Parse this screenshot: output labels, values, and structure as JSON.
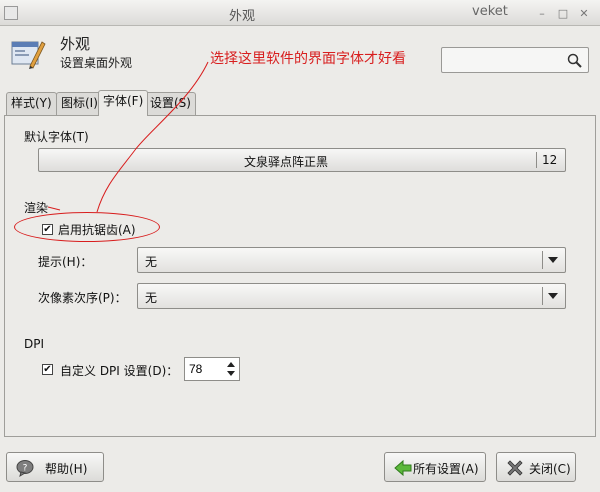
{
  "window": {
    "title": "外观",
    "wm_name": "veket"
  },
  "header": {
    "title": "外观",
    "subtitle": "设置桌面外观",
    "annotation": "选择这里软件的界面字体才好看",
    "search_placeholder": ""
  },
  "tabs": [
    {
      "label": "样式(Y)",
      "active": false
    },
    {
      "label": "图标(I)",
      "active": false
    },
    {
      "label": "字体(F)",
      "active": true
    },
    {
      "label": "设置(S)",
      "active": false
    }
  ],
  "fonts": {
    "section_label": "默认字体(T)",
    "font_name": "文泉驿点阵正黑",
    "font_size": "12"
  },
  "rendering": {
    "section_label": "渲染",
    "antialias_label": "启用抗锯齿(A)",
    "antialias_checked": true,
    "hinting_label": "提示(H)：",
    "hinting_value": "无",
    "subpixel_label": "次像素次序(P)：",
    "subpixel_value": "无"
  },
  "dpi": {
    "section_label": "DPI",
    "custom_label": "自定义 DPI 设置(D)：",
    "custom_checked": true,
    "value": "78"
  },
  "buttons": {
    "help": "帮助(H)",
    "all_settings": "所有设置(A)",
    "close": "关闭(C)"
  },
  "colors": {
    "annotation": "#d81e1e"
  }
}
